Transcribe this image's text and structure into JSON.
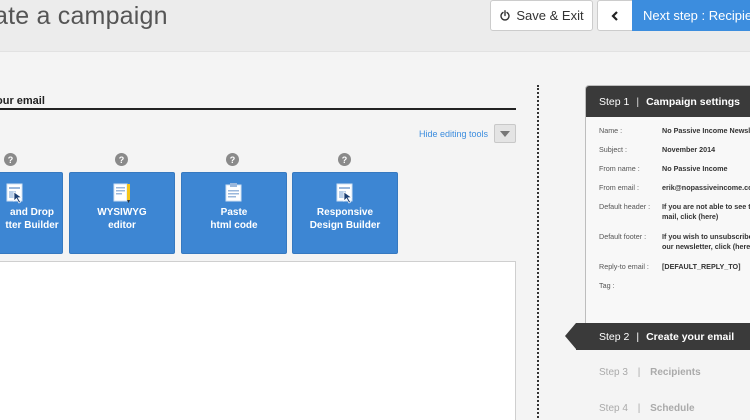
{
  "header": {
    "title": "ate a campaign",
    "save_label": "Save & Exit",
    "next_label": "Next step : Recipients"
  },
  "editor": {
    "section_title": "our email",
    "hide_tools_label": "Hide editing tools",
    "help_glyph": "?",
    "tools": [
      {
        "line1": "and Drop",
        "line2": "tter Builder",
        "icon": "drag-drop-builder-icon"
      },
      {
        "line1": "WYSIWYG",
        "line2": "editor",
        "icon": "wysiwyg-editor-icon"
      },
      {
        "line1": "Paste",
        "line2": "html code",
        "icon": "paste-html-icon"
      },
      {
        "line1": "Responsive",
        "line2": "Design Builder",
        "icon": "responsive-builder-icon"
      }
    ]
  },
  "sidebar": {
    "step1": {
      "number": "Step 1",
      "sep": "|",
      "title": "Campaign settings"
    },
    "settings": [
      {
        "key": "Name :",
        "value": "No Passive Income Newsletter"
      },
      {
        "key": "Subject :",
        "value": "November 2014"
      },
      {
        "key": "From name :",
        "value": "No Passive Income"
      },
      {
        "key": "From email :",
        "value": "erik@nopassiveincome.com"
      },
      {
        "key": "Default header :",
        "value": "If you are not able to see this",
        "value2": "mail, click (here)"
      },
      {
        "key": "Default footer :",
        "value": "If you wish to unsubscribe from",
        "value2": "our newsletter, click (here)"
      },
      {
        "key": "Reply-to email :",
        "value": "[DEFAULT_REPLY_TO]"
      },
      {
        "key": "Tag :",
        "value": ""
      }
    ],
    "step2": {
      "number": "Step 2",
      "sep": "|",
      "title": "Create your email"
    },
    "step3": {
      "number": "Step 3",
      "sep": "|",
      "title": "Recipients"
    },
    "step4": {
      "number": "Step 4",
      "sep": "|",
      "title": "Schedule"
    }
  },
  "colors": {
    "accent": "#3c8dde",
    "tool_card": "#3d86d3",
    "dark_step": "#3a3a3a"
  }
}
